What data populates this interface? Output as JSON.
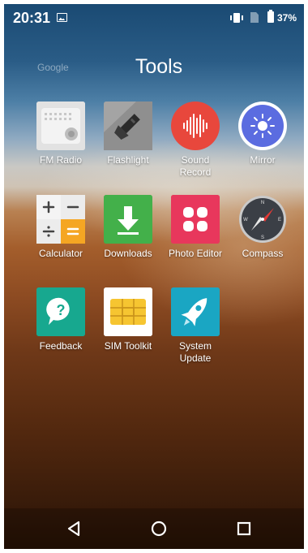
{
  "status_bar": {
    "time": "20:31",
    "battery_percent": "37%",
    "icons": [
      "gallery-notification-icon",
      "vibrate-icon",
      "no-sim-icon",
      "battery-icon"
    ]
  },
  "folder": {
    "google_label": "Google",
    "title": "Tools"
  },
  "apps": [
    {
      "label": "FM Radio",
      "icon": "radio-icon",
      "color": "#d9d9d9"
    },
    {
      "label": "Flashlight",
      "icon": "flashlight-icon",
      "color": "#9a9a9a"
    },
    {
      "label": "Sound\nRecord",
      "icon": "sound-wave-icon",
      "color": "#e8473c"
    },
    {
      "label": "Mirror",
      "icon": "sun-icon",
      "color": "#5b6ce0"
    },
    {
      "label": "Calculator",
      "icon": "calculator-icon",
      "color": "#f5a623"
    },
    {
      "label": "Downloads",
      "icon": "download-arrow-icon",
      "color": "#4caf50"
    },
    {
      "label": "Photo Editor",
      "icon": "photo-editor-icon",
      "color": "#e8375c"
    },
    {
      "label": "Compass",
      "icon": "compass-icon",
      "color": "#3b3f46"
    },
    {
      "label": "Feedback",
      "icon": "question-bubble-icon",
      "color": "#17a88f"
    },
    {
      "label": "SIM Toolkit",
      "icon": "sim-card-icon",
      "color": "#f6c531"
    },
    {
      "label": "System\nUpdate",
      "icon": "rocket-icon",
      "color": "#1aa6c3"
    }
  ],
  "nav_bar": {
    "buttons": [
      "back-icon",
      "home-icon",
      "recents-icon"
    ]
  }
}
